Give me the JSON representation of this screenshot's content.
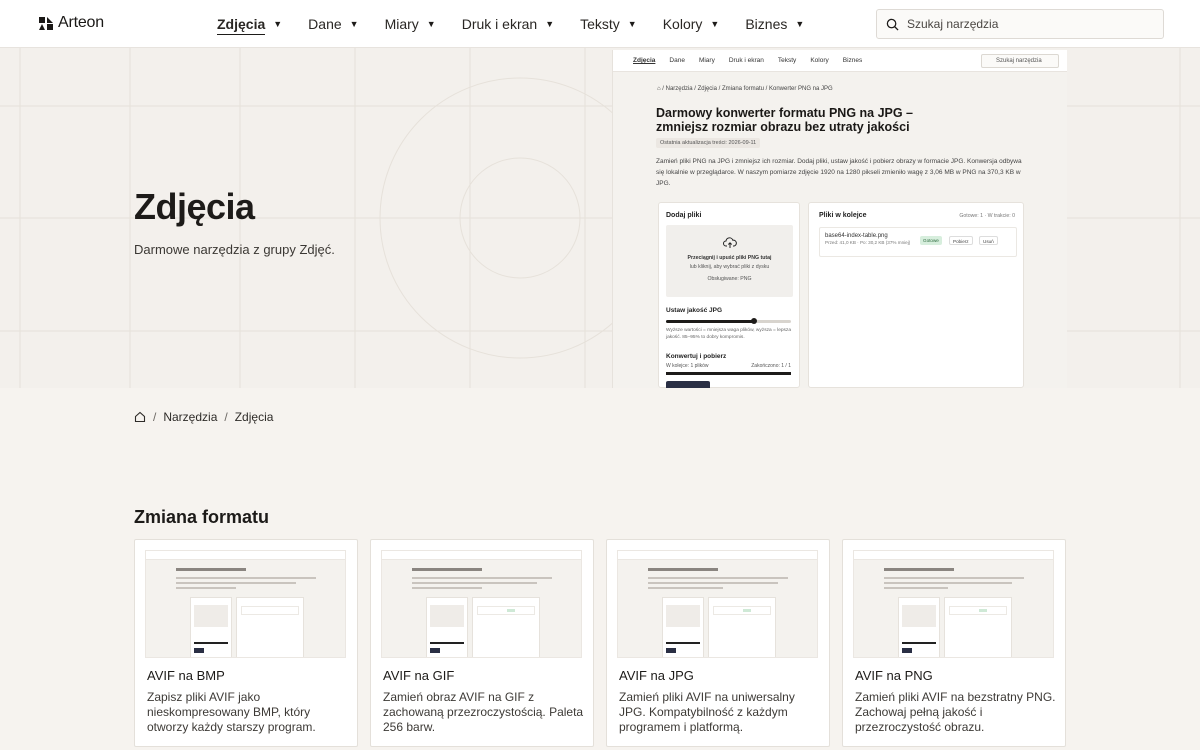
{
  "brand": {
    "name": "Arteon"
  },
  "nav": {
    "items": [
      {
        "label": "Zdjęcia",
        "active": true
      },
      {
        "label": "Dane"
      },
      {
        "label": "Miary"
      },
      {
        "label": "Druk i ekran"
      },
      {
        "label": "Teksty"
      },
      {
        "label": "Kolory"
      },
      {
        "label": "Biznes"
      }
    ],
    "caret": "▼"
  },
  "search": {
    "placeholder": "Szukaj narzędzia"
  },
  "hero": {
    "title": "Zdjęcia",
    "subtitle": "Darmowe narzędzia z grupy Zdjęć.",
    "preview": {
      "nav": [
        "Zdjęcia",
        "Dane",
        "Miary",
        "Druk i ekran",
        "Teksty",
        "Kolory",
        "Biznes"
      ],
      "search": "Szukaj narzędzia",
      "breadcrumb": "⌂ / Narzędzia / Zdjęcia / Zmiana formatu / Konwerter PNG na JPG",
      "title": "Darmowy konwerter formatu PNG na JPG – zmniejsz rozmiar obrazu bez utraty jakości",
      "date": "Ostatnia aktualizacja treści: 2026-09-11",
      "description": "Zamień pliki PNG na JPG i zmniejsz ich rozmiar. Dodaj pliki, ustaw jakość i pobierz obrazy w formacie JPG. Konwersja odbywa się lokalnie w przeglądarce. W naszym pomiarze zdjęcie 1920 na 1280 pikseli zmieniło wagę z 3,06 MB w PNG na 370,3 KB w JPG.",
      "add_files": "Dodaj pliki",
      "drop_title": "Przeciągnij i upuść pliki PNG tutaj",
      "drop_hint": "lub kliknij, aby wybrać pliki z dysku",
      "drop_supported": "Obsługiwane: PNG",
      "quality_label": "Ustaw jakość JPG",
      "quality_value": 0.7,
      "quality_note": "Wyższe wartości = mniejsza waga plików, wyższa = lepsza jakość. 85–95% to dobry kompromis.",
      "convert_label": "Konwertuj i pobierz",
      "convert_left": "W kolejce: 1 plików",
      "convert_right": "Zakończono: 1 / 1",
      "queue_title": "Pliki w kolejce",
      "queue_meta": "Gotowe: 1 · W trakcie: 0",
      "file_name": "base64-index-table.png",
      "file_size": "Przed: 41,0 KB · Po: 30,2 KB (37% mniej)",
      "chips": [
        "Gotowe",
        "Pobierz",
        "Usuń"
      ]
    }
  },
  "breadcrumb": {
    "home_icon": "home-icon",
    "items": [
      "Narzędzia",
      "Zdjęcia"
    ],
    "separator": "/"
  },
  "section": {
    "title": "Zmiana formatu",
    "cards": [
      {
        "title": "AVIF na BMP",
        "description": "Zapisz pliki AVIF jako nieskompresowany BMP, który otworzy każdy starszy program."
      },
      {
        "title": "AVIF na GIF",
        "description": "Zamień obraz AVIF na GIF z zachowaną przezroczystością. Paleta 256 barw."
      },
      {
        "title": "AVIF na JPG",
        "description": "Zamień pliki AVIF na uniwersalny JPG. Kompatybilność z każdym programem i platformą."
      },
      {
        "title": "AVIF na PNG",
        "description": "Zamień pliki AVIF na bezstratny PNG. Zachowaj pełną jakość i przezroczystość obrazu."
      }
    ]
  },
  "colors": {
    "background": "#f6f3ef",
    "text": "#1d1b19",
    "accent": "#2a2f44",
    "success": "#d7eedd"
  }
}
